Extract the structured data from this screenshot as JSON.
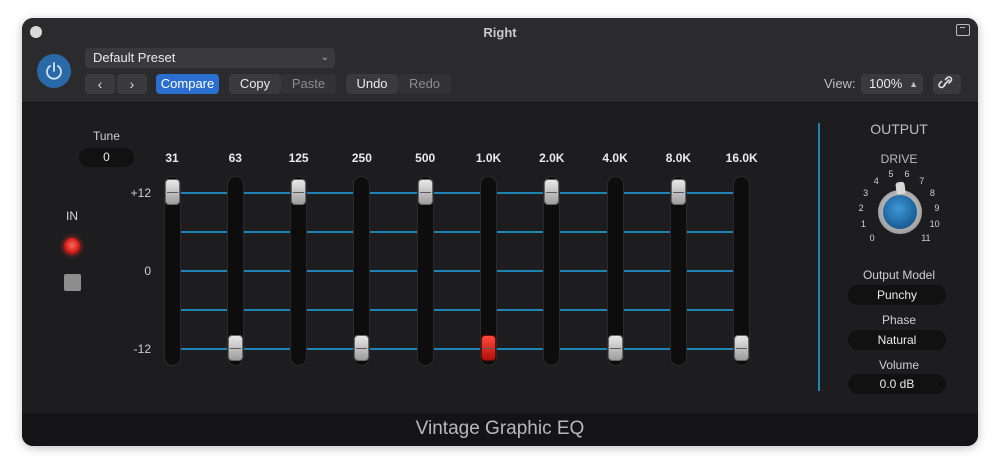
{
  "window": {
    "title": "Right"
  },
  "toolbar": {
    "preset": "Default Preset",
    "compare_label": "Compare",
    "copy_label": "Copy",
    "paste_label": "Paste",
    "undo_label": "Undo",
    "redo_label": "Redo",
    "view_label": "View:",
    "view_value": "100%",
    "accent_color": "#2a6fd0"
  },
  "eq": {
    "tune_label": "Tune",
    "tune_value": "0",
    "in_label": "IN",
    "scale": {
      "top": "+12",
      "mid": "0",
      "bottom": "-12"
    },
    "bands": [
      {
        "freq": "31",
        "gain_db": 12
      },
      {
        "freq": "63",
        "gain_db": -12
      },
      {
        "freq": "125",
        "gain_db": 12
      },
      {
        "freq": "250",
        "gain_db": -12
      },
      {
        "freq": "500",
        "gain_db": 12
      },
      {
        "freq": "1.0K",
        "gain_db": -12,
        "active": true
      },
      {
        "freq": "2.0K",
        "gain_db": 12
      },
      {
        "freq": "4.0K",
        "gain_db": -12
      },
      {
        "freq": "8.0K",
        "gain_db": 12
      },
      {
        "freq": "16.0K",
        "gain_db": -12
      }
    ],
    "line_color": "#1f84b3"
  },
  "output": {
    "title": "OUTPUT",
    "drive_label": "DRIVE",
    "drive_scale": [
      "0",
      "1",
      "2",
      "3",
      "4",
      "5",
      "6",
      "7",
      "8",
      "9",
      "10",
      "11"
    ],
    "drive_value": 5,
    "model_label": "Output Model",
    "model_value": "Punchy",
    "phase_label": "Phase",
    "phase_value": "Natural",
    "volume_label": "Volume",
    "volume_value": "0.0 dB"
  },
  "footer": {
    "plugin_name": "Vintage Graphic EQ"
  }
}
